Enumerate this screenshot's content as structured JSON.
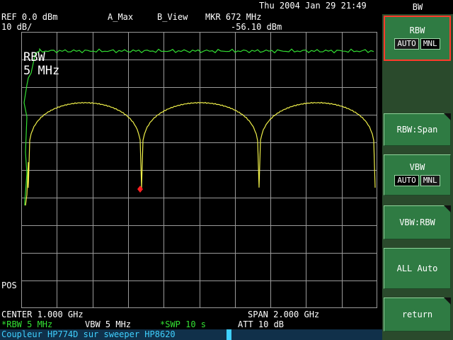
{
  "header": {
    "datetime": "Thu 2004 Jan 29 21:49",
    "ref": "REF 0.0 dBm",
    "scale": "10 dB/",
    "trace_a": "A_Max",
    "trace_b": "B_View",
    "marker_freq": "MKR 672 MHz",
    "marker_level": "-56.10 dBm"
  },
  "screen": {
    "overlay_line1": "RBW",
    "overlay_line2": "5 MHz",
    "pos_label": "POS"
  },
  "footer": {
    "center": "CENTER 1.000 GHz",
    "span": "SPAN 2.000 GHz",
    "rbw": "*RBW 5 MHz",
    "vbw": "VBW 5 MHz",
    "swp": "*SWP 10 s",
    "att": "ATT 10 dB",
    "status": "Coupleur HP774D sur sweeper HP8620"
  },
  "panel": {
    "title": "BW",
    "softkeys": [
      {
        "label": "RBW",
        "opt_a": "AUTO",
        "opt_b": "MNL",
        "selected": "MNL"
      },
      {
        "label": "RBW:Span"
      },
      {
        "label": "VBW",
        "opt_a": "AUTO",
        "opt_b": "MNL",
        "selected": "AUTO"
      },
      {
        "label": "VBW:RBW"
      },
      {
        "label": "ALL Auto"
      },
      {
        "label": "return"
      }
    ]
  },
  "colors": {
    "trace_green": "#33e033",
    "trace_yellow": "#f0f04a",
    "marker": "#ff2020",
    "grid": "#9a9a9a",
    "panel_bg": "#2a4a2c",
    "softkey_bg": "#2f7b43",
    "status_text": "#3fd0ff"
  }
}
